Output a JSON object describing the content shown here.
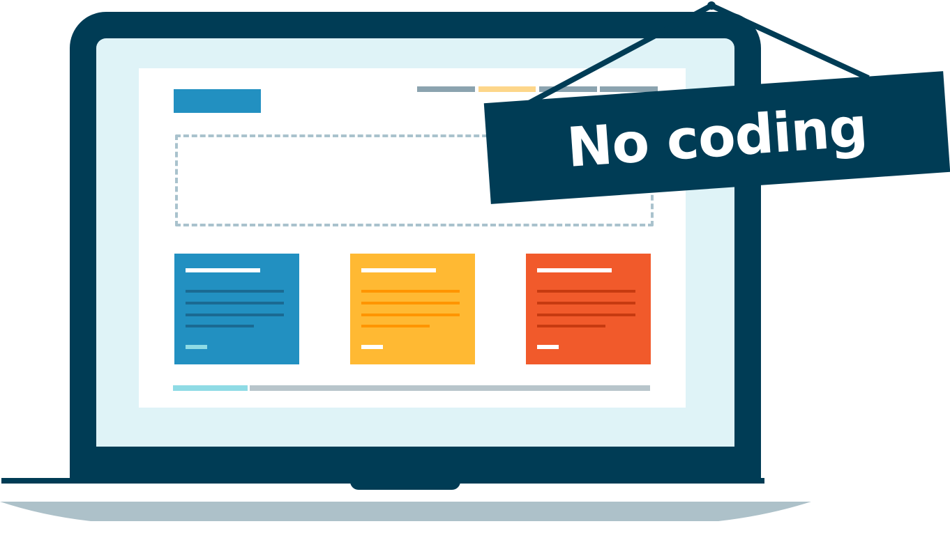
{
  "sign": {
    "text": "No coding"
  },
  "colors": {
    "frame": "#003c55",
    "screen_bg": "#dff3f7",
    "page_bg": "#ffffff",
    "logo": "#2290c1",
    "nav": [
      "#8ba3af",
      "#fdd68a",
      "#8ba3af",
      "#8ba3af"
    ],
    "placeholder_border": "#a9c2cd",
    "cards": [
      {
        "bg": "#2290c1",
        "line": "#1a6a92",
        "button": "#8fdbe5"
      },
      {
        "bg": "#ffb933",
        "line": "#ff9500",
        "button": "#ffffff"
      },
      {
        "bg": "#f15a2b",
        "line": "#c63a10",
        "button": "#ffffff"
      }
    ],
    "footer": [
      "#8fdbe5",
      "#b8c5cb"
    ],
    "base_shadow": "#adc1c9"
  }
}
